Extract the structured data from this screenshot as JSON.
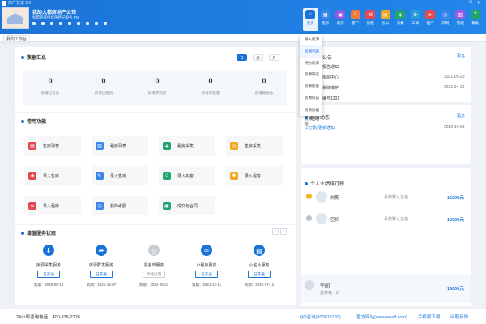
{
  "window": {
    "title": "房产管家 6.0",
    "controls": [
      "—",
      "□",
      "✕"
    ]
  },
  "shop": {
    "name": "我的大都房地产公司",
    "subtitle": "加盟商提供优质经纪服务 PM"
  },
  "nav": [
    {
      "label": "首页",
      "icon": "home-icon",
      "color": "#1b73d8",
      "glyph": "⌂"
    },
    {
      "label": "租房",
      "icon": "rent-icon",
      "color": "#3b86ea",
      "glyph": "▦"
    },
    {
      "label": "新房",
      "icon": "newhouse-icon",
      "color": "#8a5ae0",
      "glyph": "▣"
    },
    {
      "label": "客户",
      "icon": "customer-icon",
      "color": "#f07a3a",
      "glyph": "☺"
    },
    {
      "label": "招租",
      "icon": "lease-icon",
      "color": "#e7484f",
      "glyph": "⌘"
    },
    {
      "label": "办公",
      "icon": "office-icon",
      "color": "#f5a623",
      "glyph": "▤"
    },
    {
      "label": "采集",
      "icon": "collect-icon",
      "color": "#21a36b",
      "glyph": "◈"
    },
    {
      "label": "工具",
      "icon": "tool-icon",
      "color": "#2c9bd6",
      "glyph": "⚙"
    },
    {
      "label": "推广",
      "icon": "promote-icon",
      "color": "#e7484f",
      "glyph": "➤"
    },
    {
      "label": "商网",
      "icon": "shopnet-icon",
      "color": "#3b86ea",
      "glyph": "◎"
    },
    {
      "label": "管理",
      "icon": "manage-icon",
      "color": "#9a5be0",
      "glyph": "▥"
    },
    {
      "label": "帮助",
      "icon": "help-icon",
      "color": "#21a36b",
      "glyph": "?"
    }
  ],
  "tab": {
    "label": "我的工作台"
  },
  "dropdown": [
    "录入房源",
    "房源列表",
    "待办房源",
    "房源筛选",
    "房源检索",
    "房源标记",
    "房源数据",
    "房源回收站"
  ],
  "summary": {
    "title": "数据汇总",
    "segments": [
      "日",
      "周",
      "月"
    ],
    "stats": [
      {
        "value": "0",
        "label": "新增出售房"
      },
      {
        "value": "0",
        "label": "新增出租房"
      },
      {
        "value": "0",
        "label": "新增求购客"
      },
      {
        "value": "0",
        "label": "新增求租客"
      },
      {
        "value": "0",
        "label": "新增跟进数"
      }
    ]
  },
  "quick": {
    "title": "常用功能",
    "items": [
      {
        "label": "售房列表",
        "color": "#e7484f",
        "glyph": "▤"
      },
      {
        "label": "租房列表",
        "color": "#3b86ea",
        "glyph": "▥"
      },
      {
        "label": "租房采集",
        "color": "#21a36b",
        "glyph": "◈"
      },
      {
        "label": "售房采集",
        "color": "#f5a623",
        "glyph": "◎"
      },
      {
        "label": "录入售房",
        "color": "#e7484f",
        "glyph": "✚"
      },
      {
        "label": "录入售房",
        "color": "#3b86ea",
        "glyph": "✎"
      },
      {
        "label": "录入买客",
        "color": "#21a36b",
        "glyph": "☺"
      },
      {
        "label": "录入租客",
        "color": "#f5a623",
        "glyph": "☻"
      },
      {
        "label": "录入租房",
        "color": "#e7484f",
        "glyph": "✒"
      },
      {
        "label": "我的考勤",
        "color": "#3b86ea",
        "glyph": "◷"
      },
      {
        "label": "成交与合同",
        "color": "#21a36b",
        "glyph": "▣"
      }
    ]
  },
  "services": {
    "title": "增值服务状态",
    "items": [
      {
        "name": "房源采集服务",
        "button": "已开通",
        "date": "到期：2026-05-13",
        "color": "#1b73d8",
        "glyph": "⬇"
      },
      {
        "name": "房源群发服务",
        "button": "已开通",
        "date": "到期：2021-12-07",
        "color": "#1b73d8",
        "glyph": "➦"
      },
      {
        "name": "黑名单服务",
        "button": "即将过期",
        "date": "到期：2021-06-23",
        "color": "#c9ced6",
        "glyph": "▯"
      },
      {
        "name": "小程序服务",
        "button": "已开通",
        "date": "到期：2021-12-11",
        "color": "#1b73d8",
        "glyph": "∞"
      },
      {
        "name": "小名片服务",
        "button": "已开通",
        "date": "到期：2021-07-12",
        "color": "#1b73d8",
        "glyph": "▤"
      }
    ]
  },
  "notice": {
    "title": "公告",
    "more": "更多",
    "items": [
      {
        "text": "报告通知",
        "date": ""
      },
      {
        "text": "房源中心",
        "date": "2021-05-25"
      },
      {
        "text": "系统维护",
        "date": "2021-04-26"
      },
      {
        "text": "编号1231",
        "date": ""
      }
    ]
  },
  "news": {
    "title": "新房动态",
    "more": "更多",
    "item": "[1记录] 更新通知",
    "date": "2020-10-09"
  },
  "ranking": {
    "title": "个人业绩排行榜",
    "rows": [
      {
        "name": "刘斯",
        "desc": "系统默认总值",
        "value": "15000元"
      },
      {
        "name": "空间",
        "desc": "系统默认总值",
        "value": "10000元"
      }
    ],
    "me": {
      "name": "空间",
      "desc": "总排名：2",
      "value": "15000元"
    }
  },
  "status": {
    "hotline": "24小时咨询电话：400-836-2226",
    "qq": "QQ咨询(800018189)",
    "site": "官方网站(www.eeaff.com)",
    "download": "手机版下载",
    "feedback": "问题反馈"
  }
}
